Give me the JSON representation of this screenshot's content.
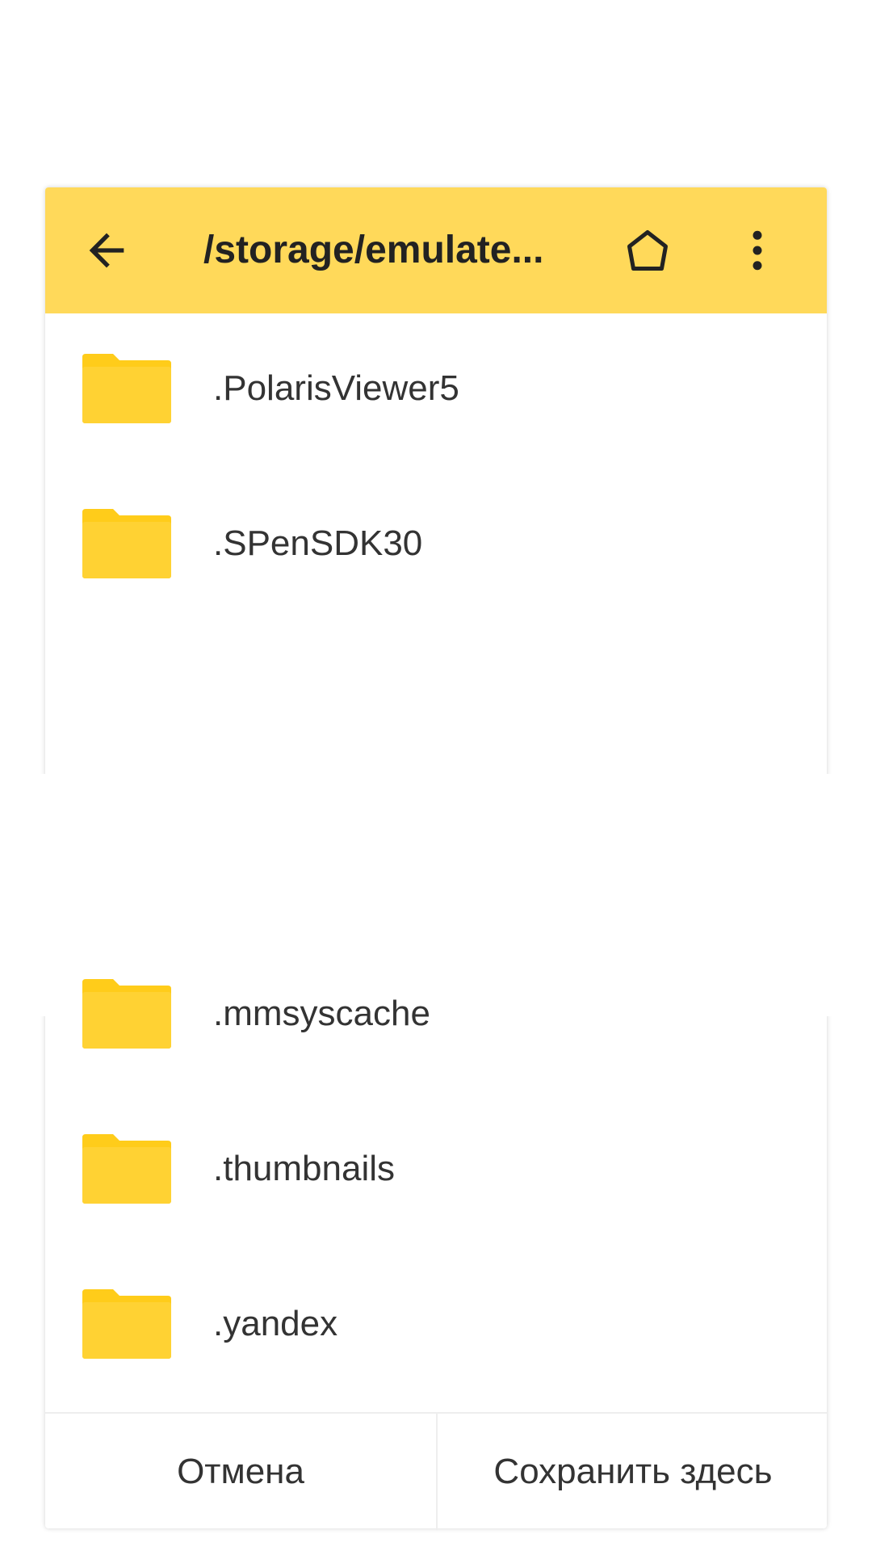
{
  "toolbar": {
    "path": "/storage/emulate...",
    "colors": {
      "background": "#ffd95a"
    },
    "icons": {
      "back": "arrow-left-icon",
      "home": "home-icon",
      "more": "more-vert-icon"
    }
  },
  "list": {
    "folder_color": "#ffcc1a",
    "items_top": [
      {
        "label": ".PolarisViewer5"
      },
      {
        "label": ".SPenSDK30"
      }
    ],
    "items_bottom": [
      {
        "label": ".mmsyscache"
      },
      {
        "label": ".thumbnails"
      },
      {
        "label": ".yandex"
      }
    ]
  },
  "footer": {
    "cancel_label": "Отмена",
    "save_label": "Сохранить здесь"
  }
}
